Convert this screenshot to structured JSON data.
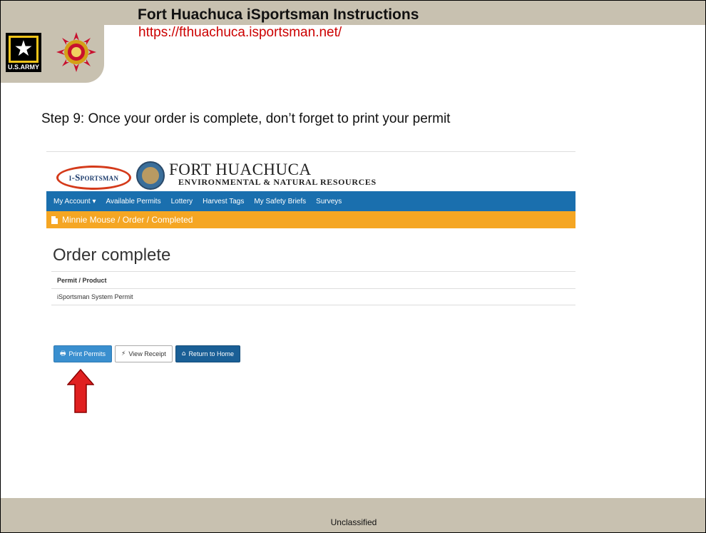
{
  "slide": {
    "title": "Fort Huachuca iSportsman Instructions",
    "url": "https://fthuachuca.isportsman.net/",
    "step_text": "Step 9: Once your order is complete, don’t forget to print your permit",
    "footer": "Unclassified",
    "army_logo_text": "U.S.ARMY"
  },
  "site": {
    "isportsman_logo": "i-Sportsman",
    "brand_name": "FORT HUACHUCA",
    "brand_subtitle": "ENVIRONMENTAL & NATURAL RESOURCES",
    "nav": [
      "My Account ▾",
      "Available Permits",
      "Lottery",
      "Harvest Tags",
      "My Safety Briefs",
      "Surveys"
    ],
    "breadcrumb": "Minnie Mouse / Order / Completed",
    "heading": "Order complete",
    "table": {
      "header": "Permit / Product",
      "rows": [
        "iSportsman System Permit"
      ]
    },
    "buttons": {
      "print": "Print Permits",
      "receipt": "View Receipt",
      "home": "Return to Home"
    }
  },
  "colors": {
    "band": "#c8c1b0",
    "url_red": "#cc0000",
    "navbar": "#1a6fae",
    "breadcrumb": "#f5a623",
    "arrow": "#e02020"
  },
  "icons": {
    "army": "army-star-icon",
    "seal": "fort-seal-icon",
    "breadcrumb": "document-icon",
    "print": "print-icon",
    "receipt": "bolt-icon",
    "home": "home-icon",
    "arrow": "up-arrow-icon"
  }
}
